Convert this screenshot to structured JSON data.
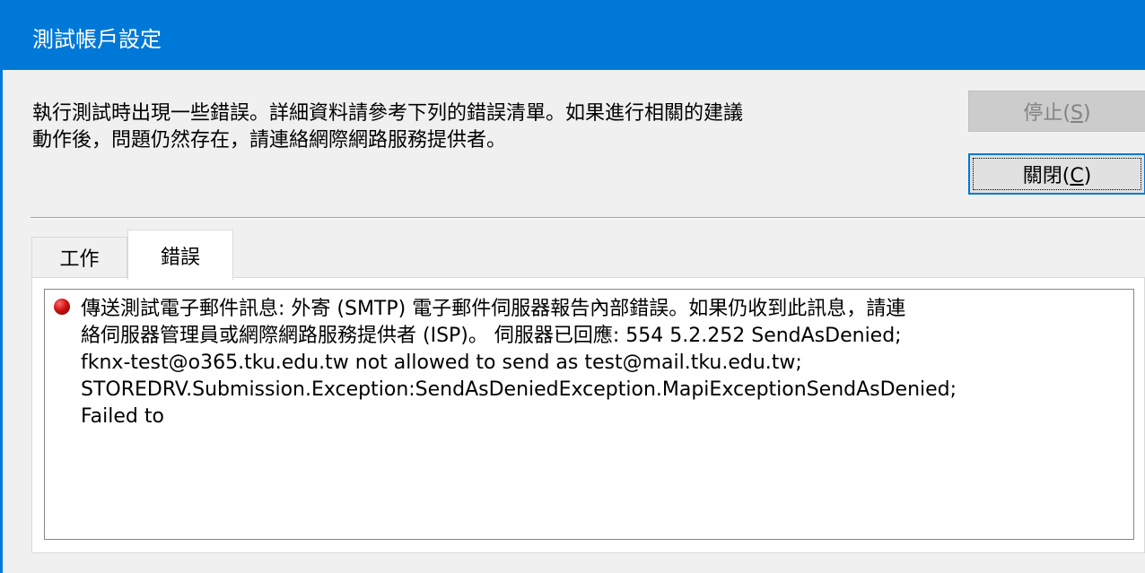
{
  "window": {
    "title": "測試帳戶設定"
  },
  "message": {
    "text": "執行測試時出現一些錯誤。詳細資料請參考下列的錯誤清單。如果進行相關的建議\n動作後，問題仍然存在，請連絡網際網路服務提供者。"
  },
  "buttons": {
    "stop": {
      "label_main": "停止(",
      "accesskey": "S",
      "label_end": ")",
      "enabled": false
    },
    "close": {
      "label_main": "關閉(",
      "accesskey": "C",
      "label_end": ")",
      "enabled": true
    }
  },
  "tabs": [
    {
      "label": "工作",
      "selected": false
    },
    {
      "label": "錯誤",
      "selected": true
    }
  ],
  "errors": [
    {
      "icon": "error-icon",
      "text": "傳送測試電子郵件訊息: 外寄 (SMTP) 電子郵件伺服器報告內部錯誤。如果仍收到此訊息，請連\n絡伺服器管理員或網際網路服務提供者 (ISP)。 伺服器已回應: 554 5.2.252 SendAsDenied;\nfknx-test@o365.tku.edu.tw not allowed to send as test@mail.tku.edu.tw;\nSTOREDRV.Submission.Exception:SendAsDeniedException.MapiExceptionSendAsDenied;\nFailed to"
    }
  ],
  "colors": {
    "titlebar": "#0078d7",
    "error_icon": "#d11212"
  }
}
